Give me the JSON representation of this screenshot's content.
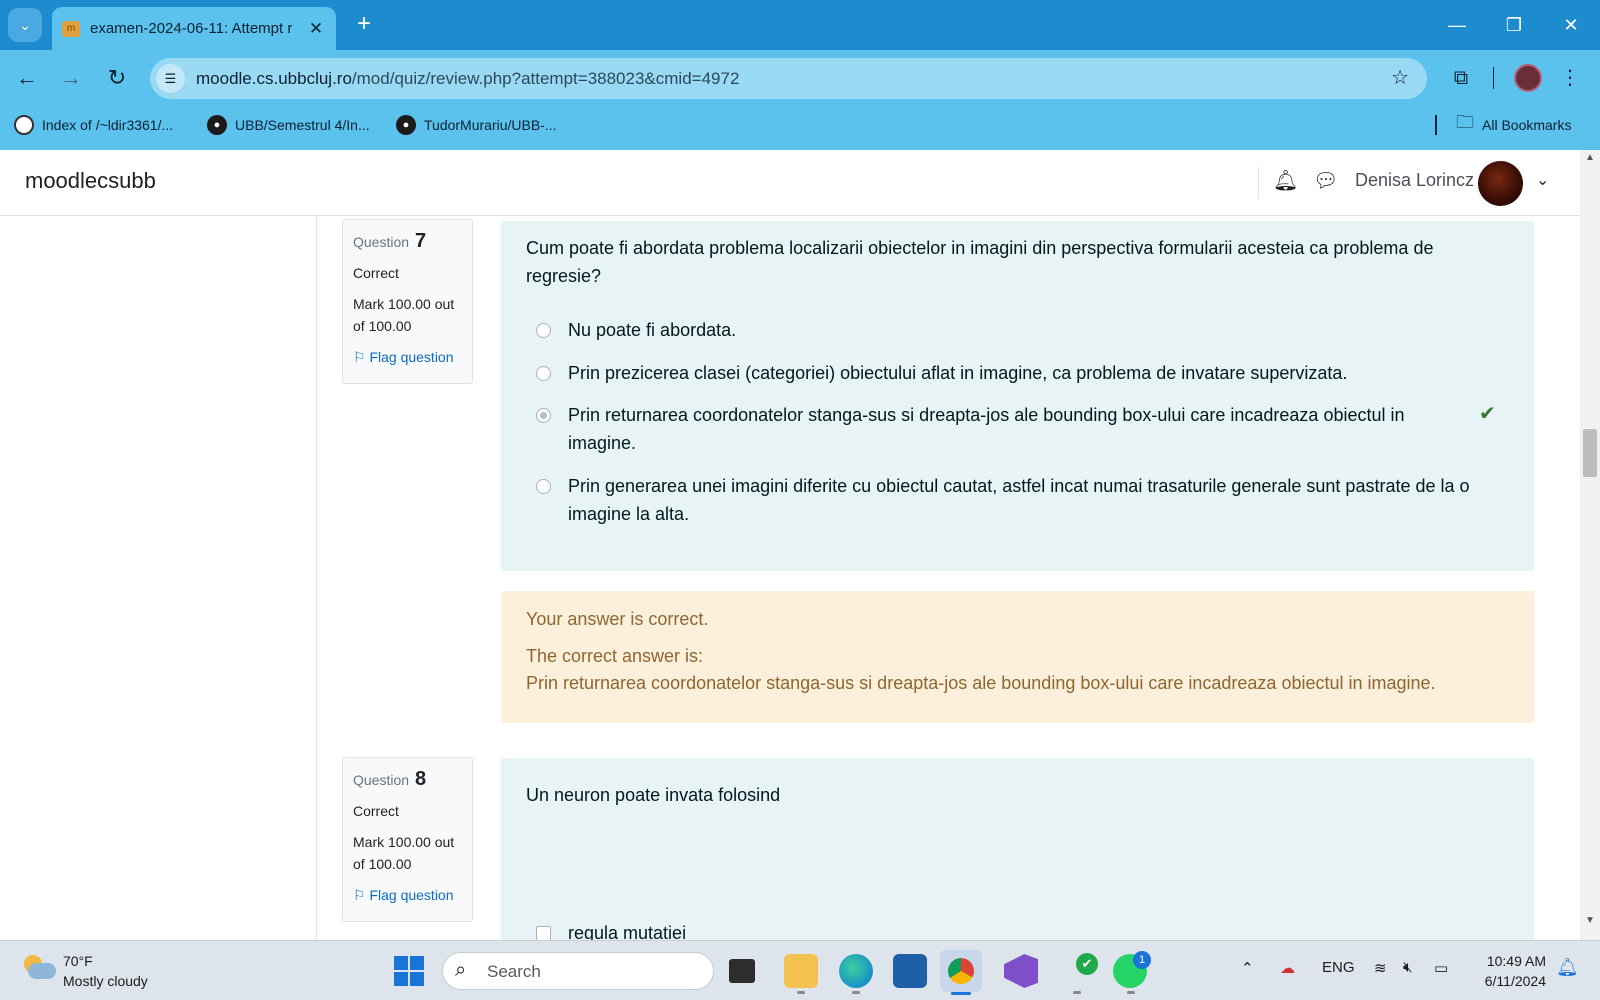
{
  "browser": {
    "tab_title": "examen-2024-06-11: Attempt r",
    "new_tab": "+",
    "url_host": "moodle.cs.ubbcluj.ro",
    "url_path": "/mod/quiz/review.php?attempt=388023&cmid=4972",
    "bookmarks": [
      {
        "label": "Index of /~ldir3361/..."
      },
      {
        "label": "UBB/Semestrul 4/In..."
      },
      {
        "label": "TudorMurariu/UBB-..."
      }
    ],
    "all_bookmarks": "All Bookmarks"
  },
  "moodle": {
    "brand": "moodlecsubb",
    "username": "Denisa Lorincz"
  },
  "questions": [
    {
      "label": "Question",
      "number": "7",
      "state": "Correct",
      "mark": "Mark 100.00 out of 100.00",
      "flag": "Flag question",
      "text": "Cum poate fi abordata problema localizarii obiectelor in imagini din perspectiva formularii acesteia ca problema de regresie?",
      "answers": [
        {
          "text": "Nu poate fi abordata.",
          "selected": false
        },
        {
          "text": "Prin prezicerea clasei (categoriei) obiectului aflat in imagine, ca problema de invatare supervizata.",
          "selected": false
        },
        {
          "text": "Prin returnarea coordonatelor stanga-sus si dreapta-jos ale bounding box-ului care incadreaza obiectul in imagine.",
          "selected": true
        },
        {
          "text": "Prin generarea unei imagini diferite cu obiectul cautat, astfel incat numai trasaturile generale sunt pastrate de la o imagine la alta.",
          "selected": false
        }
      ],
      "feedback": {
        "result": "Your answer is correct.",
        "correct_intro": "The correct answer is:",
        "correct_answer": "Prin returnarea coordonatelor stanga-sus si dreapta-jos ale bounding box-ului care incadreaza obiectul in imagine."
      }
    },
    {
      "label": "Question",
      "number": "8",
      "state": "Correct",
      "mark": "Mark 100.00 out of 100.00",
      "flag": "Flag question",
      "text": "Un neuron poate invata folosind",
      "answers": [
        {
          "text": "regula mutatiei",
          "selected": false
        }
      ]
    }
  ],
  "taskbar": {
    "temperature": "70°F",
    "weather": "Mostly cloudy",
    "search_placeholder": "Search",
    "language": "ENG",
    "time": "10:49 AM",
    "date": "6/11/2024",
    "whatsapp_badge": "1"
  }
}
